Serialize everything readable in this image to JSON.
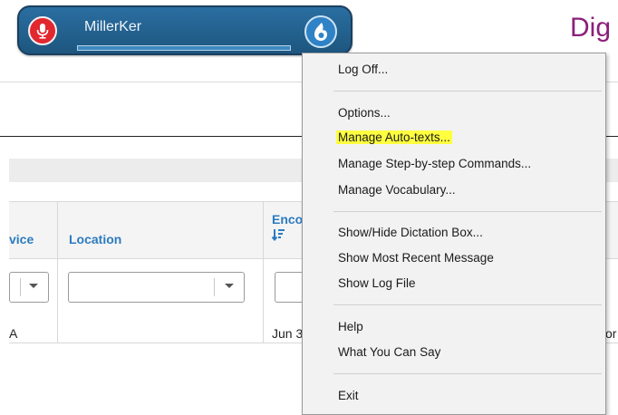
{
  "dictation_bar": {
    "user_name": "MillerKer",
    "mic_icon": "microphone-icon",
    "menu_button_icon": "dragon-flame-icon",
    "colors": {
      "bar": "#1f5f8e",
      "mic": "#e2272f",
      "flame_button": "#2f82c6"
    }
  },
  "page": {
    "title_partial": "Dig",
    "table": {
      "headers": {
        "device_partial": "vice",
        "location": "Location",
        "encounter_partial": "Enco"
      },
      "sort_icon": "sort-descending-icon",
      "row": {
        "device_partial": "A",
        "encounter_partial": "Jun 3",
        "trailing_partial": "or"
      }
    }
  },
  "context_menu": {
    "items": [
      {
        "label": "Log Off..."
      },
      {
        "label": "Options..."
      },
      {
        "label": "Manage Auto-texts...",
        "highlighted": true
      },
      {
        "label": "Manage Step-by-step Commands..."
      },
      {
        "label": "Manage Vocabulary..."
      },
      {
        "label": "Show/Hide Dictation Box..."
      },
      {
        "label": "Show Most Recent Message"
      },
      {
        "label": "Show Log File"
      },
      {
        "label": "Help"
      },
      {
        "label": "What You Can Say"
      },
      {
        "label": "Exit"
      }
    ],
    "highlight_color": "#ffff40"
  }
}
